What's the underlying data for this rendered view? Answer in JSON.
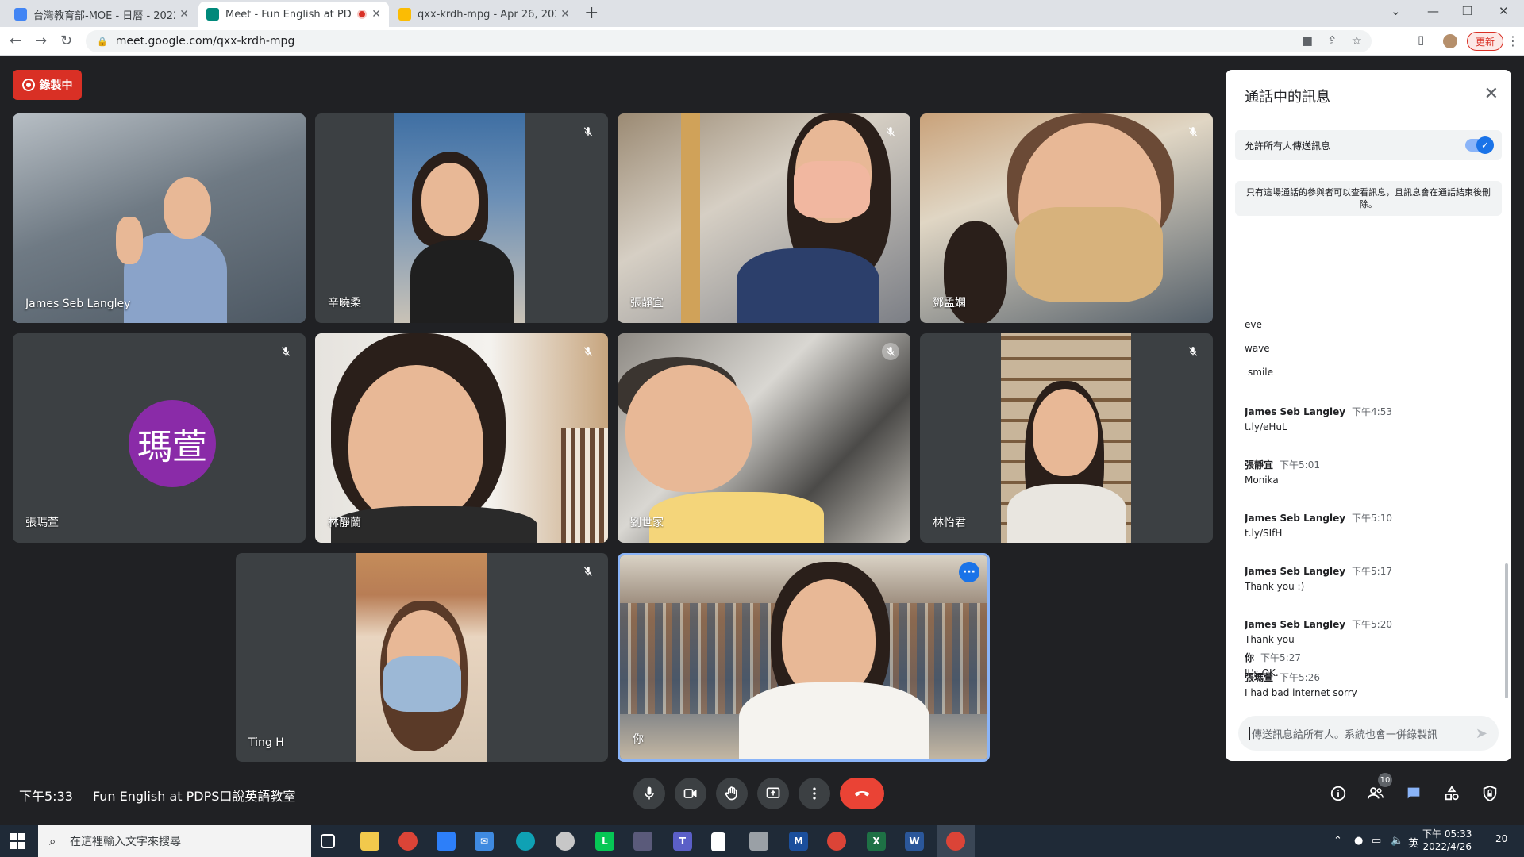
{
  "browser": {
    "tabs": [
      {
        "title": "台灣教育部-MOE - 日曆 - 2022年",
        "favicon_color": "#4285f4"
      },
      {
        "title": "Meet - Fun English at PDPS",
        "favicon_color": "#00897b"
      },
      {
        "title": "qxx-krdh-mpg - Apr 26, 2022 -",
        "favicon_color": "#fbbc04"
      }
    ],
    "url": "meet.google.com/qxx-krdh-mpg",
    "update_label": "更新"
  },
  "recording_label": "錄製中",
  "participants": [
    {
      "name": "James Seb Langley"
    },
    {
      "name": "辛曉柔"
    },
    {
      "name": "張靜宜"
    },
    {
      "name": "鄧孟嫻"
    },
    {
      "name": "張瑪萱",
      "initials": "瑪萱"
    },
    {
      "name": "林靜蘭"
    },
    {
      "name": "劉世家"
    },
    {
      "name": "林怡君"
    },
    {
      "name": "Ting H"
    },
    {
      "name": "你"
    }
  ],
  "meeting": {
    "time": "下午5:33",
    "title": "Fun English at PDPS口說英語教室",
    "participant_count": "10"
  },
  "chat": {
    "title": "通話中的訊息",
    "allow_label": "允許所有人傳送訊息",
    "notice": "只有這場通話的參與者可以查看訊息，且訊息會在通話結束後刪除。",
    "plain_lines": [
      "eve",
      "wave",
      "smile"
    ],
    "messages": [
      {
        "sender": "James Seb Langley",
        "time": "下午4:53",
        "text": "t.ly/eHuL"
      },
      {
        "sender": "張靜宜",
        "time": "下午5:01",
        "text": "Monika"
      },
      {
        "sender": "James Seb Langley",
        "time": "下午5:10",
        "text": "t.ly/SIfH"
      },
      {
        "sender": "James Seb Langley",
        "time": "下午5:17",
        "text": "Thank you :)"
      },
      {
        "sender": "James Seb Langley",
        "time": "下午5:20",
        "text": "Thank you"
      },
      {
        "sender": "張瑪萱",
        "time": "下午5:26",
        "text": "I had bad internet sorry"
      },
      {
        "sender": "你",
        "time": "下午5:27",
        "text": "It's OK."
      }
    ],
    "input_placeholder": "傳送訊息給所有人。系統也會一併錄製訊"
  },
  "taskbar": {
    "search_placeholder": "在這裡輸入文字來搜尋",
    "lang": "英",
    "clock_time": "下午 05:33",
    "clock_date": "2022/4/26",
    "notif_count": "20"
  }
}
